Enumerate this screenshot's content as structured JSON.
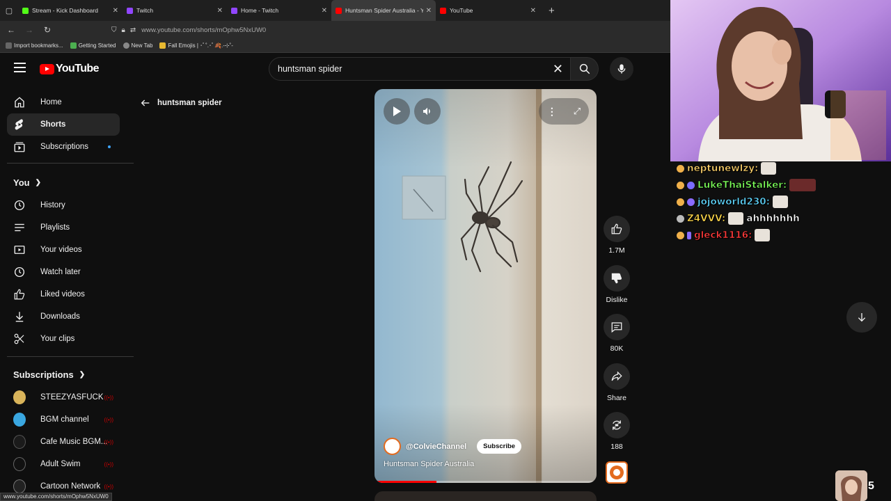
{
  "browser": {
    "tabs": [
      {
        "title": "Stream - Kick Dashboard",
        "color": "#53fc18"
      },
      {
        "title": "Twitch",
        "color": "#9146ff"
      },
      {
        "title": "Home - Twitch",
        "color": "#9146ff"
      },
      {
        "title": "Huntsman Spider Australia - Yo",
        "color": "#ff0000"
      },
      {
        "title": "YouTube",
        "color": "#ff0000"
      }
    ],
    "url": "www.youtube.com/shorts/mOphw5NxUW0",
    "bookmarks": [
      "Import bookmarks...",
      "Getting Started",
      "New Tab",
      "Fall Emojis | ･ﾟ˚.･ﾟ🍂.-⊹˚-"
    ],
    "status_url": "www.youtube.com/shorts/mOphw5NxUW0"
  },
  "youtube": {
    "logo_text": "YouTube",
    "search_value": "huntsman spider",
    "back_label": "huntsman spider",
    "sidebar": {
      "main": [
        "Home",
        "Shorts",
        "Subscriptions"
      ],
      "you_label": "You",
      "you_items": [
        "History",
        "Playlists",
        "Your videos",
        "Watch later",
        "Liked videos",
        "Downloads",
        "Your clips"
      ],
      "subs_label": "Subscriptions",
      "subs": [
        "STEEZYASFUCK",
        "BGM channel",
        "Cafe Music BGM...",
        "Adult Swim",
        "Cartoon Network"
      ]
    },
    "video": {
      "channel": "@ColvieChannel",
      "subscribe": "Subscribe",
      "title": "Huntsman Spider Australia",
      "progress": 0.28
    },
    "actions": {
      "likes": "1.7M",
      "dislike": "Dislike",
      "comments": "80K",
      "share": "Share",
      "remix": "188"
    }
  },
  "chat": [
    {
      "user": "neptunewlzy:",
      "color": "#ffd36b",
      "text": ""
    },
    {
      "user": "LukeThaiStalker:",
      "color": "#7dff5a",
      "text": ""
    },
    {
      "user": "jojoworld230:",
      "color": "#5fd7ff",
      "text": ""
    },
    {
      "user": "Z4VVV:",
      "color": "#ffd84a",
      "text": "ahhhhhhh"
    },
    {
      "user": "gleck1116:",
      "color": "#ff3b3b",
      "text": ""
    }
  ],
  "viewer_count": "5"
}
